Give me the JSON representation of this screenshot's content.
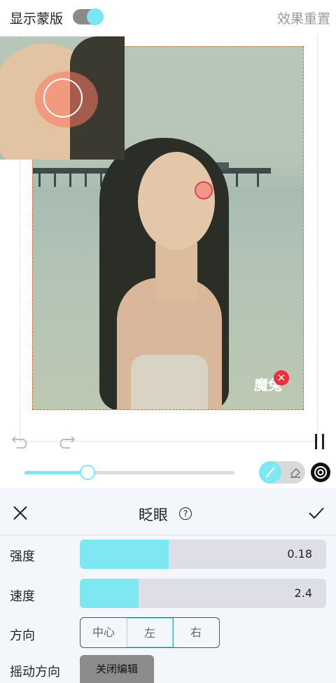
{
  "topbar": {
    "mask_label": "显示蒙版",
    "mask_toggle_on": true,
    "reset_label": "效果重置"
  },
  "photo": {
    "watermark": "魔兔"
  },
  "brush_slider": {
    "value_fraction": 0.3
  },
  "panel": {
    "title": "眨眼",
    "help_icon": "?",
    "rows": {
      "strength": {
        "label": "强度",
        "value": "0.18",
        "fill_fraction": 0.36
      },
      "speed": {
        "label": "速度",
        "value": "2.4",
        "fill_fraction": 0.24
      },
      "direction": {
        "label": "方向",
        "options": [
          "中心",
          "左",
          "右"
        ],
        "selected": "左"
      },
      "sway": {
        "label": "摇动方向",
        "button": "关闭编辑"
      }
    }
  },
  "colors": {
    "accent": "#7ee8f2",
    "mask_border": "#e07030",
    "eye_marker": "#e04060"
  }
}
